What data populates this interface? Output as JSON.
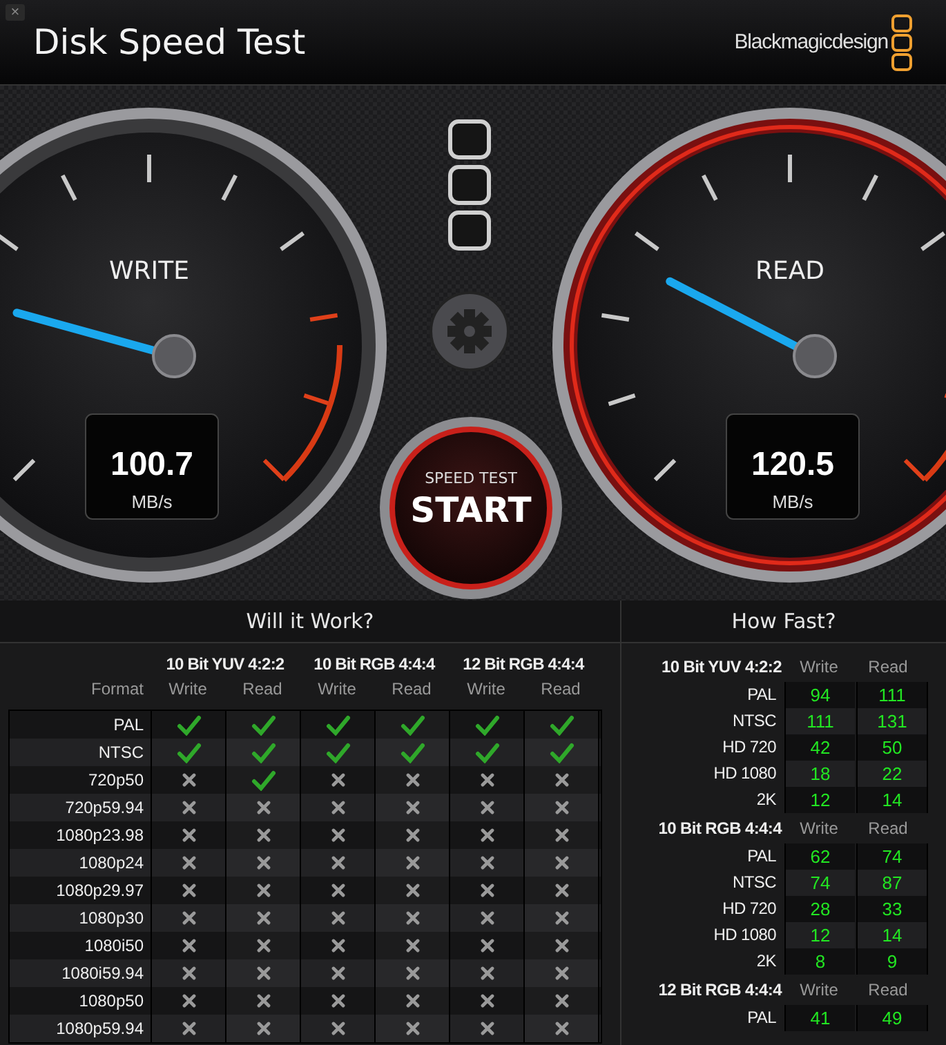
{
  "window": {
    "title": "Disk Speed Test",
    "close": "×"
  },
  "brand": "Blackmagicdesign",
  "gauges": [
    {
      "label": "WRITE",
      "value": "100.7",
      "unit": "MB/s",
      "active": false
    },
    {
      "label": "READ",
      "value": "120.5",
      "unit": "MB/s",
      "active": true
    }
  ],
  "start_button": {
    "caption": "SPEED TEST",
    "label": "START"
  },
  "will_it_work": {
    "title": "Will it Work?",
    "format_label": "Format",
    "groups": [
      "10 Bit YUV 4:2:2",
      "10 Bit RGB 4:4:4",
      "12 Bit RGB 4:4:4"
    ],
    "columns": [
      "Write",
      "Read",
      "Write",
      "Read",
      "Write",
      "Read"
    ],
    "rows": [
      {
        "format": "PAL",
        "cells": [
          true,
          true,
          true,
          true,
          true,
          true
        ]
      },
      {
        "format": "NTSC",
        "cells": [
          true,
          true,
          true,
          true,
          true,
          true
        ]
      },
      {
        "format": "720p50",
        "cells": [
          false,
          true,
          false,
          false,
          false,
          false
        ]
      },
      {
        "format": "720p59.94",
        "cells": [
          false,
          false,
          false,
          false,
          false,
          false
        ]
      },
      {
        "format": "1080p23.98",
        "cells": [
          false,
          false,
          false,
          false,
          false,
          false
        ]
      },
      {
        "format": "1080p24",
        "cells": [
          false,
          false,
          false,
          false,
          false,
          false
        ]
      },
      {
        "format": "1080p29.97",
        "cells": [
          false,
          false,
          false,
          false,
          false,
          false
        ]
      },
      {
        "format": "1080p30",
        "cells": [
          false,
          false,
          false,
          false,
          false,
          false
        ]
      },
      {
        "format": "1080i50",
        "cells": [
          false,
          false,
          false,
          false,
          false,
          false
        ]
      },
      {
        "format": "1080i59.94",
        "cells": [
          false,
          false,
          false,
          false,
          false,
          false
        ]
      },
      {
        "format": "1080p50",
        "cells": [
          false,
          false,
          false,
          false,
          false,
          false
        ]
      },
      {
        "format": "1080p59.94",
        "cells": [
          false,
          false,
          false,
          false,
          false,
          false
        ]
      }
    ]
  },
  "how_fast": {
    "title": "How Fast?",
    "sections": [
      {
        "name": "10 Bit YUV 4:2:2",
        "write_label": "Write",
        "read_label": "Read",
        "rows": [
          {
            "format": "PAL",
            "write": "94",
            "read": "111"
          },
          {
            "format": "NTSC",
            "write": "111",
            "read": "131"
          },
          {
            "format": "HD 720",
            "write": "42",
            "read": "50"
          },
          {
            "format": "HD 1080",
            "write": "18",
            "read": "22"
          },
          {
            "format": "2K",
            "write": "12",
            "read": "14"
          }
        ]
      },
      {
        "name": "10 Bit RGB 4:4:4",
        "write_label": "Write",
        "read_label": "Read",
        "rows": [
          {
            "format": "PAL",
            "write": "62",
            "read": "74"
          },
          {
            "format": "NTSC",
            "write": "74",
            "read": "87"
          },
          {
            "format": "HD 720",
            "write": "28",
            "read": "33"
          },
          {
            "format": "HD 1080",
            "write": "12",
            "read": "14"
          },
          {
            "format": "2K",
            "write": "8",
            "read": "9"
          }
        ]
      },
      {
        "name": "12 Bit RGB 4:4:4",
        "write_label": "Write",
        "read_label": "Read",
        "rows": [
          {
            "format": "PAL",
            "write": "41",
            "read": "49"
          }
        ]
      }
    ]
  }
}
